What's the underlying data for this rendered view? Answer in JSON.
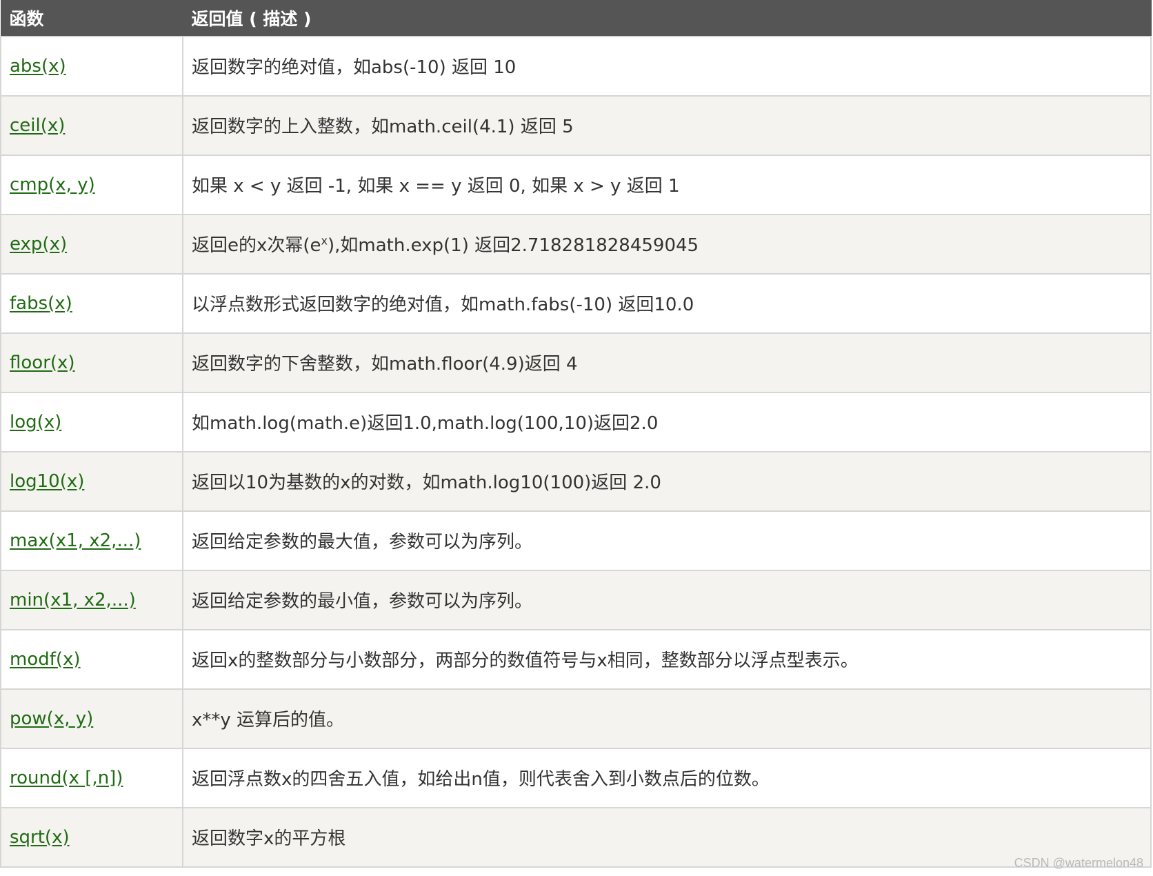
{
  "header": {
    "col_function": "函数",
    "col_description": "返回值 ( 描述 )"
  },
  "rows": [
    {
      "fn": "abs(x)",
      "desc": "返回数字的绝对值，如abs(-10) 返回 10"
    },
    {
      "fn": "ceil(x)",
      "desc": "返回数字的上入整数，如math.ceil(4.1) 返回 5"
    },
    {
      "fn": "cmp(x, y)",
      "desc": "如果 x < y 返回 -1, 如果 x == y 返回 0, 如果 x > y 返回 1"
    },
    {
      "fn": "exp(x)",
      "desc_before": "返回e的x次幂(e",
      "desc_sup": "x",
      "desc_after": "),如math.exp(1) 返回2.718281828459045"
    },
    {
      "fn": "fabs(x)",
      "desc": "以浮点数形式返回数字的绝对值，如math.fabs(-10) 返回10.0"
    },
    {
      "fn": "floor(x)",
      "desc": "返回数字的下舍整数，如math.floor(4.9)返回 4"
    },
    {
      "fn": "log(x)",
      "desc": "如math.log(math.e)返回1.0,math.log(100,10)返回2.0"
    },
    {
      "fn": "log10(x)",
      "desc": "返回以10为基数的x的对数，如math.log10(100)返回 2.0"
    },
    {
      "fn": "max(x1, x2,...)",
      "desc": "返回给定参数的最大值，参数可以为序列。"
    },
    {
      "fn": "min(x1, x2,...)",
      "desc": "返回给定参数的最小值，参数可以为序列。"
    },
    {
      "fn": "modf(x)",
      "desc": "返回x的整数部分与小数部分，两部分的数值符号与x相同，整数部分以浮点型表示。"
    },
    {
      "fn": "pow(x, y)",
      "desc": "x**y 运算后的值。"
    },
    {
      "fn": "round(x [,n])",
      "desc": "返回浮点数x的四舍五入值，如给出n值，则代表舍入到小数点后的位数。"
    },
    {
      "fn": "sqrt(x)",
      "desc": "返回数字x的平方根"
    }
  ],
  "watermark": "CSDN @watermelon48",
  "colors": {
    "header_bg": "#555555",
    "link": "#1f6b12",
    "stripe": "#f4f3ef",
    "border": "#d6d6d6"
  }
}
